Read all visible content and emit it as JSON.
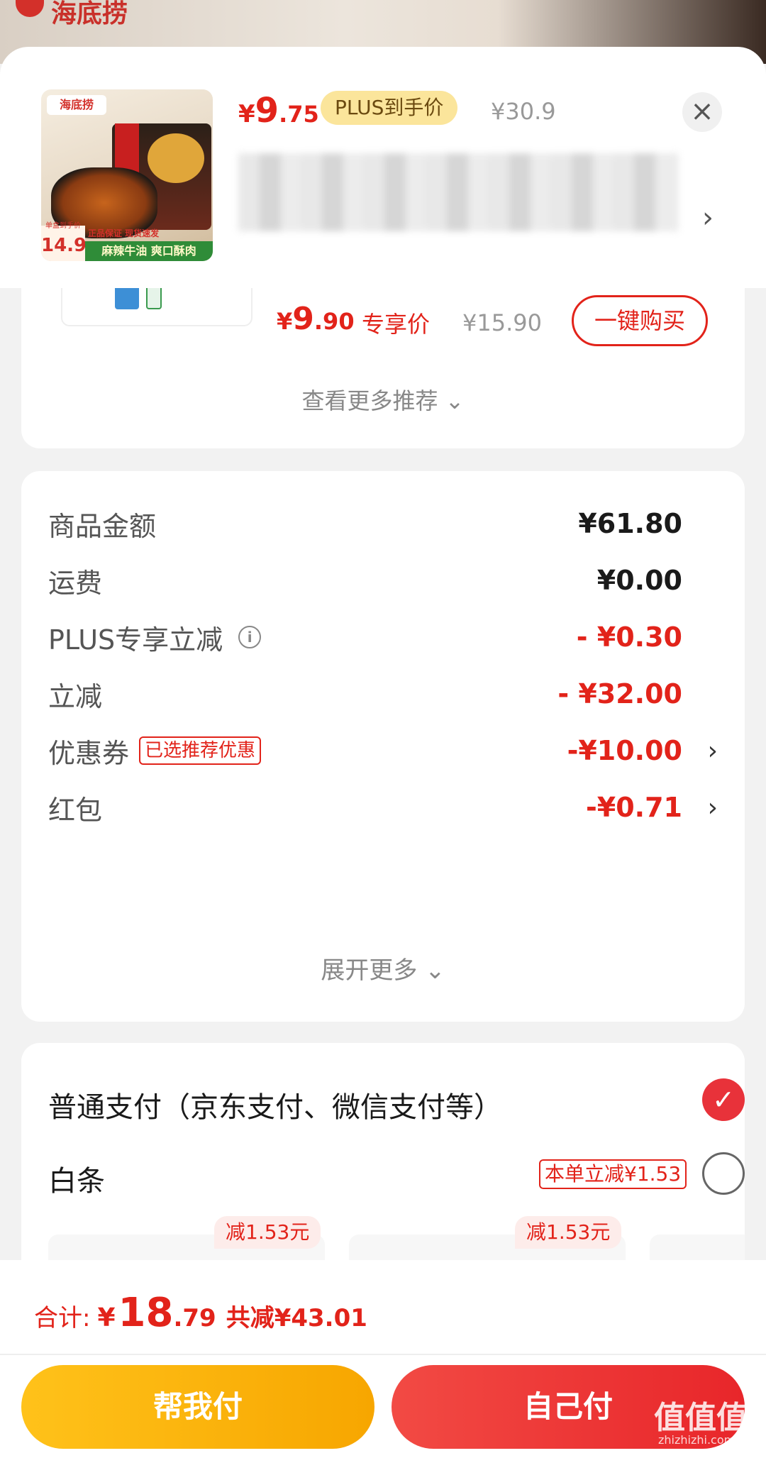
{
  "backdrop": {
    "brand": "海底捞"
  },
  "header": {
    "thumb": {
      "logo": "海底捞",
      "price_mini_label": "单盒到手价",
      "price_tag": "14.9",
      "guarantee": "正品保证 现货速发",
      "slogan": "麻辣牛油 爽口酥肉"
    },
    "price_currency": "¥",
    "price_int": "9",
    "price_dec": ".75",
    "plus_badge": "PLUS到手价",
    "orig_price": "¥30.9",
    "close_glyph": "×",
    "title_arrow": "›"
  },
  "recommendation": {
    "price_currency": "¥",
    "price_int": "9",
    "price_dec": ".90",
    "tag": "专享价",
    "orig_price": "¥15.90",
    "buy_button": "一键购买",
    "more_link": "查看更多推荐 ⌄"
  },
  "detail": {
    "rows": [
      {
        "label": "商品金额",
        "value": "¥61.80"
      },
      {
        "label": "运费",
        "value": "¥0.00"
      },
      {
        "label": "PLUS专享立减",
        "value": "- ¥0.30",
        "info_icon": "i"
      },
      {
        "label": "立减",
        "value": "- ¥32.00"
      },
      {
        "label": "优惠券",
        "tag": "已选推荐优惠",
        "value": "-¥10.00",
        "arrow": "›"
      },
      {
        "label": "红包",
        "value": "-¥0.71",
        "arrow": "›"
      }
    ],
    "expand_more": "展开更多 ⌄"
  },
  "payment": {
    "normal": {
      "label": "普通支付（京东支付、微信支付等）",
      "check": "✓"
    },
    "baitiao": {
      "label": "白条",
      "promo": "本单立减¥1.53"
    },
    "installments": [
      {
        "badge": "减1.53元"
      },
      {
        "badge": "减1.53元"
      }
    ]
  },
  "bottom": {
    "total_label": "合计:",
    "currency": "¥",
    "total_int": "18",
    "total_dec": ".79",
    "saved": "共减¥43.01",
    "help_pay": "帮我付",
    "self_pay": "自己付",
    "watermark": "值值值",
    "watermark_sub": "zhizhizhi.com"
  },
  "colors": {
    "accent_red": "#e2231a",
    "plus_gold": "#fbe59b",
    "help_btn": "#ffc21a",
    "self_btn": "#e8262a"
  }
}
